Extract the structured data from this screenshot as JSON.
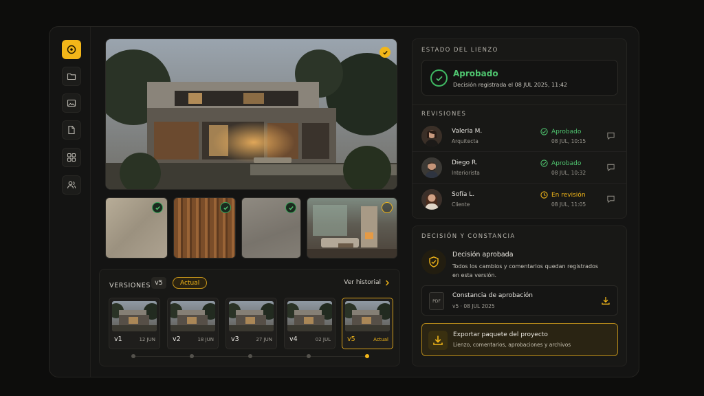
{
  "sidebar": {
    "items": [
      {
        "icon": "target-icon",
        "active": true
      },
      {
        "icon": "folder-icon"
      },
      {
        "icon": "image-icon"
      },
      {
        "icon": "document-icon"
      },
      {
        "icon": "grid-icon"
      },
      {
        "icon": "users-icon"
      }
    ]
  },
  "canvas": {
    "hero_status": "approved",
    "thumbnails": [
      {
        "name": "stone-texture",
        "status": "approved"
      },
      {
        "name": "wood-slats",
        "status": "approved"
      },
      {
        "name": "concrete-texture",
        "status": "approved"
      },
      {
        "name": "interior-living",
        "status": "pending"
      }
    ]
  },
  "versions": {
    "title": "VERSIONES",
    "count": "v5",
    "current_badge": "Actual",
    "history_link": "Ver historial",
    "items": [
      {
        "name": "v1",
        "date": "12 JUN"
      },
      {
        "name": "v2",
        "date": "18 JUN"
      },
      {
        "name": "v3",
        "date": "27 JUN"
      },
      {
        "name": "v4",
        "date": "02 JUL"
      },
      {
        "name": "v5",
        "date": "Actual"
      }
    ]
  },
  "canvas_state": {
    "title": "ESTADO DEL LIENZO",
    "status": "Aprobado",
    "detail": "Decisión registrada el 08 JUL 2025, 11:42"
  },
  "reviews": {
    "title": "REVISIONES",
    "items": [
      {
        "name": "Valeria M.",
        "role": "Arquitecta",
        "status": "Aprobado",
        "date": "08 JUL, 10:15",
        "kind": "ok"
      },
      {
        "name": "Diego R.",
        "role": "Interiorista",
        "status": "Aprobado",
        "date": "08 JUL, 10:32",
        "kind": "ok"
      },
      {
        "name": "Sofía L.",
        "role": "Cliente",
        "status": "En revisión",
        "date": "08 JUL, 11:05",
        "kind": "wait"
      }
    ]
  },
  "decision": {
    "title": "DECISIÓN Y CONSTANCIA",
    "heading": "Decisión aprobada",
    "text": "Todos los cambios y comentarios quedan registrados en esta versión.",
    "doc_type": "PDF",
    "doc_title": "Constancia de aprobación",
    "doc_sub": "v5 · 08 JUL 2025",
    "export_title": "Exportar paquete del proyecto",
    "export_sub": "Lienzo, comentarios, aprobaciones y archivos"
  },
  "colors": {
    "accent": "#f2b619",
    "success": "#4fc46f",
    "background": "#0d0d0c"
  }
}
